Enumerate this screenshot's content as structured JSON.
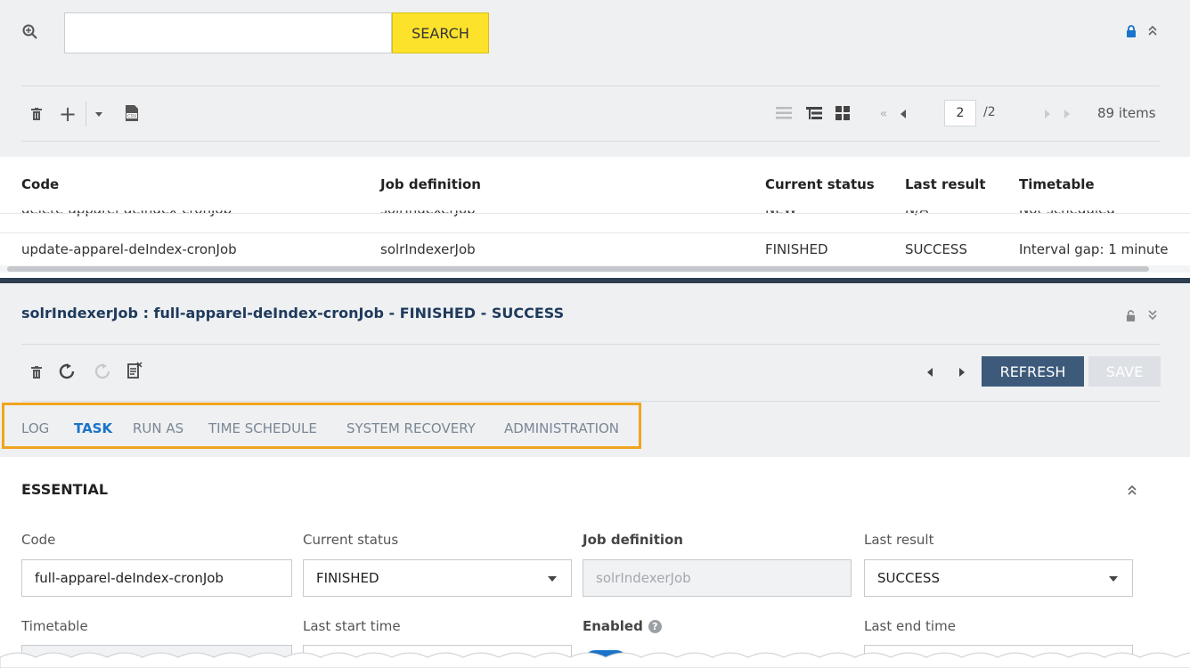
{
  "search": {
    "placeholder": "",
    "button_label": "SEARCH"
  },
  "pagination": {
    "current_page": "2",
    "total": "/2",
    "items_count": "89 items"
  },
  "table": {
    "headers": [
      "Code",
      "Job definition",
      "Current status",
      "Last result",
      "Timetable"
    ],
    "partial_row": [
      "delete-apparel-deIndex-cronJob",
      "solrIndexerJob",
      "NEW",
      "N/A",
      "Not scheduled"
    ],
    "rows": [
      [
        "update-apparel-deIndex-cronJob",
        "solrIndexerJob",
        "FINISHED",
        "SUCCESS",
        "Interval gap: 1 minute"
      ]
    ]
  },
  "editor": {
    "title": "solrIndexerJob : full-apparel-deIndex-cronJob - FINISHED - SUCCESS",
    "refresh_label": "REFRESH",
    "save_label": "SAVE",
    "tabs": [
      "LOG",
      "TASK",
      "RUN AS",
      "TIME SCHEDULE",
      "SYSTEM RECOVERY",
      "ADMINISTRATION"
    ],
    "active_tab": "TASK",
    "section_title": "ESSENTIAL",
    "fields": {
      "code": {
        "label": "Code",
        "value": "full-apparel-deIndex-cronJob"
      },
      "current_status": {
        "label": "Current status",
        "value": "FINISHED"
      },
      "job_definition": {
        "label": "Job definition",
        "value": "solrIndexerJob"
      },
      "last_result": {
        "label": "Last result",
        "value": "SUCCESS"
      },
      "timetable": {
        "label": "Timetable"
      },
      "last_start_time": {
        "label": "Last start time"
      },
      "enabled": {
        "label": "Enabled"
      },
      "last_end_time": {
        "label": "Last end time"
      }
    }
  },
  "colors": {
    "search_button": "#fde22b",
    "accent_blue": "#1a73c9",
    "refresh_button": "#3d5a7a",
    "highlight_border": "#f0a51e"
  }
}
